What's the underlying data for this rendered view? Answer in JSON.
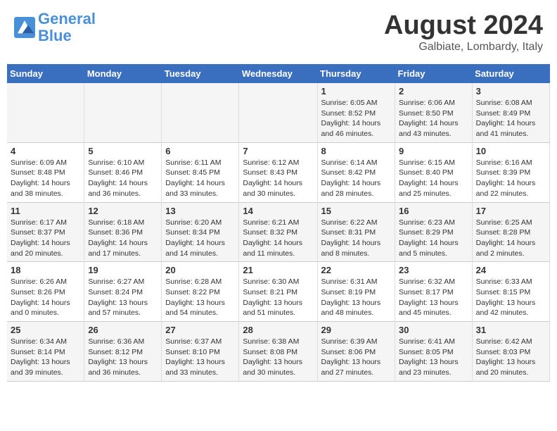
{
  "header": {
    "logo_line1": "General",
    "logo_line2": "Blue",
    "month": "August 2024",
    "location": "Galbiate, Lombardy, Italy"
  },
  "weekdays": [
    "Sunday",
    "Monday",
    "Tuesday",
    "Wednesday",
    "Thursday",
    "Friday",
    "Saturday"
  ],
  "weeks": [
    [
      {
        "day": "",
        "info": ""
      },
      {
        "day": "",
        "info": ""
      },
      {
        "day": "",
        "info": ""
      },
      {
        "day": "",
        "info": ""
      },
      {
        "day": "1",
        "info": "Sunrise: 6:05 AM\nSunset: 8:52 PM\nDaylight: 14 hours\nand 46 minutes."
      },
      {
        "day": "2",
        "info": "Sunrise: 6:06 AM\nSunset: 8:50 PM\nDaylight: 14 hours\nand 43 minutes."
      },
      {
        "day": "3",
        "info": "Sunrise: 6:08 AM\nSunset: 8:49 PM\nDaylight: 14 hours\nand 41 minutes."
      }
    ],
    [
      {
        "day": "4",
        "info": "Sunrise: 6:09 AM\nSunset: 8:48 PM\nDaylight: 14 hours\nand 38 minutes."
      },
      {
        "day": "5",
        "info": "Sunrise: 6:10 AM\nSunset: 8:46 PM\nDaylight: 14 hours\nand 36 minutes."
      },
      {
        "day": "6",
        "info": "Sunrise: 6:11 AM\nSunset: 8:45 PM\nDaylight: 14 hours\nand 33 minutes."
      },
      {
        "day": "7",
        "info": "Sunrise: 6:12 AM\nSunset: 8:43 PM\nDaylight: 14 hours\nand 30 minutes."
      },
      {
        "day": "8",
        "info": "Sunrise: 6:14 AM\nSunset: 8:42 PM\nDaylight: 14 hours\nand 28 minutes."
      },
      {
        "day": "9",
        "info": "Sunrise: 6:15 AM\nSunset: 8:40 PM\nDaylight: 14 hours\nand 25 minutes."
      },
      {
        "day": "10",
        "info": "Sunrise: 6:16 AM\nSunset: 8:39 PM\nDaylight: 14 hours\nand 22 minutes."
      }
    ],
    [
      {
        "day": "11",
        "info": "Sunrise: 6:17 AM\nSunset: 8:37 PM\nDaylight: 14 hours\nand 20 minutes."
      },
      {
        "day": "12",
        "info": "Sunrise: 6:18 AM\nSunset: 8:36 PM\nDaylight: 14 hours\nand 17 minutes."
      },
      {
        "day": "13",
        "info": "Sunrise: 6:20 AM\nSunset: 8:34 PM\nDaylight: 14 hours\nand 14 minutes."
      },
      {
        "day": "14",
        "info": "Sunrise: 6:21 AM\nSunset: 8:32 PM\nDaylight: 14 hours\nand 11 minutes."
      },
      {
        "day": "15",
        "info": "Sunrise: 6:22 AM\nSunset: 8:31 PM\nDaylight: 14 hours\nand 8 minutes."
      },
      {
        "day": "16",
        "info": "Sunrise: 6:23 AM\nSunset: 8:29 PM\nDaylight: 14 hours\nand 5 minutes."
      },
      {
        "day": "17",
        "info": "Sunrise: 6:25 AM\nSunset: 8:28 PM\nDaylight: 14 hours\nand 2 minutes."
      }
    ],
    [
      {
        "day": "18",
        "info": "Sunrise: 6:26 AM\nSunset: 8:26 PM\nDaylight: 14 hours\nand 0 minutes."
      },
      {
        "day": "19",
        "info": "Sunrise: 6:27 AM\nSunset: 8:24 PM\nDaylight: 13 hours\nand 57 minutes."
      },
      {
        "day": "20",
        "info": "Sunrise: 6:28 AM\nSunset: 8:22 PM\nDaylight: 13 hours\nand 54 minutes."
      },
      {
        "day": "21",
        "info": "Sunrise: 6:30 AM\nSunset: 8:21 PM\nDaylight: 13 hours\nand 51 minutes."
      },
      {
        "day": "22",
        "info": "Sunrise: 6:31 AM\nSunset: 8:19 PM\nDaylight: 13 hours\nand 48 minutes."
      },
      {
        "day": "23",
        "info": "Sunrise: 6:32 AM\nSunset: 8:17 PM\nDaylight: 13 hours\nand 45 minutes."
      },
      {
        "day": "24",
        "info": "Sunrise: 6:33 AM\nSunset: 8:15 PM\nDaylight: 13 hours\nand 42 minutes."
      }
    ],
    [
      {
        "day": "25",
        "info": "Sunrise: 6:34 AM\nSunset: 8:14 PM\nDaylight: 13 hours\nand 39 minutes."
      },
      {
        "day": "26",
        "info": "Sunrise: 6:36 AM\nSunset: 8:12 PM\nDaylight: 13 hours\nand 36 minutes."
      },
      {
        "day": "27",
        "info": "Sunrise: 6:37 AM\nSunset: 8:10 PM\nDaylight: 13 hours\nand 33 minutes."
      },
      {
        "day": "28",
        "info": "Sunrise: 6:38 AM\nSunset: 8:08 PM\nDaylight: 13 hours\nand 30 minutes."
      },
      {
        "day": "29",
        "info": "Sunrise: 6:39 AM\nSunset: 8:06 PM\nDaylight: 13 hours\nand 27 minutes."
      },
      {
        "day": "30",
        "info": "Sunrise: 6:41 AM\nSunset: 8:05 PM\nDaylight: 13 hours\nand 23 minutes."
      },
      {
        "day": "31",
        "info": "Sunrise: 6:42 AM\nSunset: 8:03 PM\nDaylight: 13 hours\nand 20 minutes."
      }
    ]
  ]
}
